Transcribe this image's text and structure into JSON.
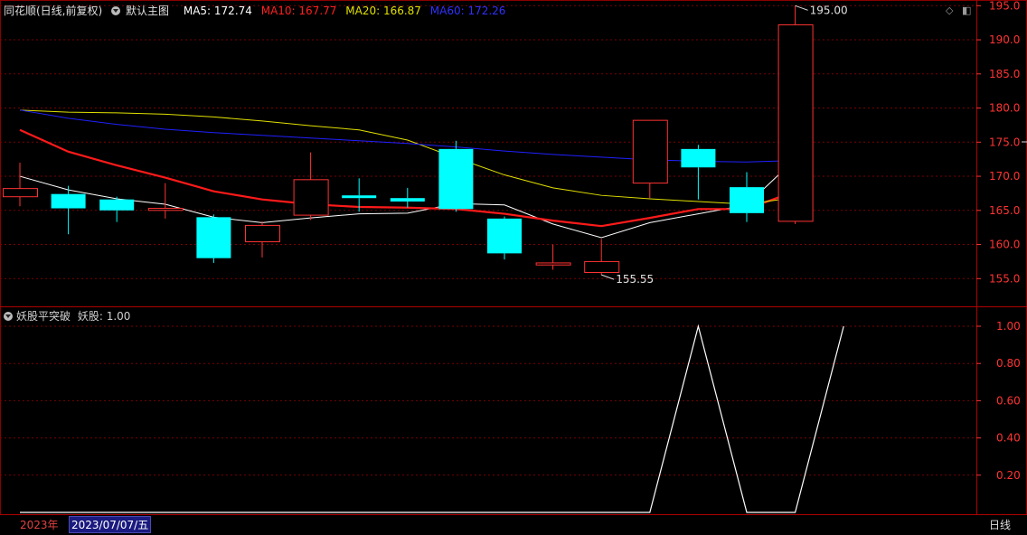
{
  "header": {
    "stock_name": "同花顺(日线,前复权)",
    "main_chart_label": "默认主图",
    "ma": [
      {
        "label": "MA5: 172.74",
        "color": "#ffffff"
      },
      {
        "label": "MA10: 167.77",
        "color": "#ff2020"
      },
      {
        "label": "MA20: 166.87",
        "color": "#e0e000"
      },
      {
        "label": "MA60: 172.26",
        "color": "#2020ff"
      }
    ]
  },
  "indicator_header": {
    "name": "妖股平突破",
    "value_label": "妖股: 1.00"
  },
  "bottom": {
    "year": "2023年",
    "current_date": "2023/07/07/五",
    "period": "日线"
  },
  "icons": {
    "diamond": "◇",
    "panel": "◧"
  },
  "colors": {
    "up": "#ff3333",
    "down": "#00ffff",
    "grid": "#7a0000",
    "axis_text": "#ff3333"
  },
  "chart_data": [
    {
      "type": "candlestick",
      "title": "",
      "ylim": [
        153.5,
        197
      ],
      "y_ticks": [
        "195.0",
        "190.0",
        "185.0",
        "180.0",
        "175.0",
        "170.0",
        "165.0",
        "160.0",
        "155.0"
      ],
      "candles": [
        {
          "open": 167.0,
          "close": 168.2,
          "high": 172.0,
          "low": 165.6
        },
        {
          "open": 167.4,
          "close": 165.3,
          "high": 168.6,
          "low": 161.5
        },
        {
          "open": 166.6,
          "close": 165.0,
          "high": 167.0,
          "low": 163.3
        },
        {
          "open": 165.0,
          "close": 165.3,
          "high": 169.0,
          "low": 163.8
        },
        {
          "open": 164.0,
          "close": 158.0,
          "high": 164.4,
          "low": 157.3
        },
        {
          "open": 160.4,
          "close": 162.8,
          "high": 163.4,
          "low": 158.1
        },
        {
          "open": 164.3,
          "close": 169.5,
          "high": 173.5,
          "low": 163.6
        },
        {
          "open": 167.2,
          "close": 166.8,
          "high": 169.7,
          "low": 164.8
        },
        {
          "open": 166.8,
          "close": 166.3,
          "high": 168.3,
          "low": 165.4
        },
        {
          "open": 174.0,
          "close": 165.2,
          "high": 175.2,
          "low": 164.8
        },
        {
          "open": 163.8,
          "close": 158.7,
          "high": 164.1,
          "low": 157.8
        },
        {
          "open": 157.0,
          "close": 157.3,
          "high": 160.0,
          "low": 156.3
        },
        {
          "open": 155.9,
          "close": 157.5,
          "high": 160.8,
          "low": 155.55
        },
        {
          "open": 169.0,
          "close": 178.2,
          "high": 178.2,
          "low": 166.8
        },
        {
          "open": 174.0,
          "close": 171.3,
          "high": 174.6,
          "low": 166.6
        },
        {
          "open": 168.4,
          "close": 164.6,
          "high": 170.6,
          "low": 163.3
        },
        {
          "open": 163.4,
          "close": 192.2,
          "high": 195.0,
          "low": 163.0
        }
      ],
      "ma_series": [
        {
          "name": "MA5",
          "values": [
            170.0,
            168.0,
            166.7,
            165.9,
            164.0,
            163.2,
            163.9,
            164.5,
            164.6,
            166.0,
            165.8,
            163.0,
            161.0,
            163.2,
            164.5,
            165.8,
            172.5
          ]
        },
        {
          "name": "MA10",
          "values": [
            176.8,
            173.6,
            171.6,
            169.8,
            167.8,
            166.6,
            165.9,
            165.5,
            165.4,
            165.2,
            164.5,
            163.5,
            162.7,
            163.9,
            165.2,
            165.2,
            167.8
          ]
        },
        {
          "name": "MA20",
          "values": [
            179.7,
            179.4,
            179.3,
            179.1,
            178.7,
            178.1,
            177.4,
            176.8,
            175.3,
            172.7,
            170.2,
            168.3,
            167.2,
            166.7,
            166.3,
            165.9,
            166.9
          ]
        },
        {
          "name": "MA60",
          "values": [
            179.7,
            178.5,
            177.6,
            176.9,
            176.4,
            176.0,
            175.6,
            175.2,
            174.8,
            174.3,
            173.7,
            173.2,
            172.8,
            172.4,
            172.2,
            172.1,
            172.3
          ]
        }
      ],
      "annotations": [
        {
          "text": "195.00",
          "candle": 16,
          "value": 195.0
        },
        {
          "text": "155.55",
          "candle": 12,
          "value": 155.55
        }
      ]
    },
    {
      "type": "line",
      "title": "",
      "ylim": [
        0,
        1.05
      ],
      "y_ticks": [
        "1.00",
        "0.80",
        "0.60",
        "0.40",
        "0.20"
      ],
      "series": [
        {
          "name": "妖股",
          "values": [
            0,
            0,
            0,
            0,
            0,
            0,
            0,
            0,
            0,
            0,
            0,
            0,
            0,
            0,
            1,
            0,
            0,
            1
          ]
        }
      ]
    }
  ]
}
